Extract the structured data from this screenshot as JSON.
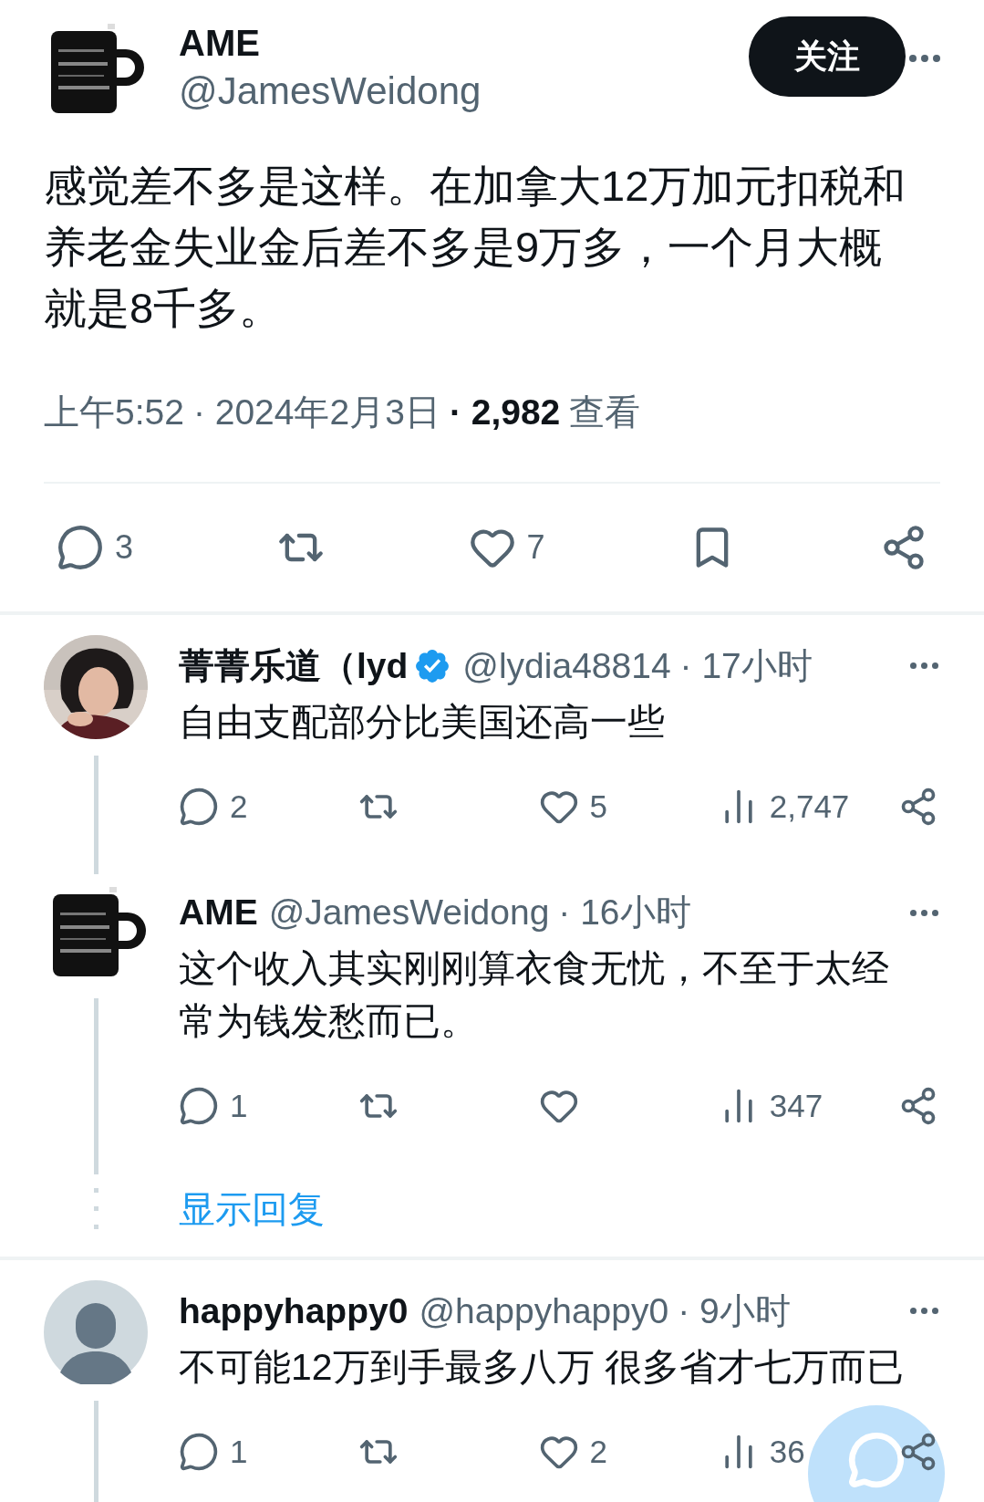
{
  "main_tweet": {
    "avatar": {
      "kind": "mug"
    },
    "author_name": "AME",
    "handle": "@JamesWeidong",
    "follow_button": "关注",
    "body": "感觉差不多是这样。在加拿大12万加元扣税和养老金失业金后差不多是9万多，一个月大概就是8千多。",
    "time": "上午5:52",
    "date": "· 2024年2月3日",
    "views": "· 2,982",
    "views_label": "查看",
    "actions": [
      {
        "kind": "reply",
        "count": "3"
      },
      {
        "kind": "retweet"
      },
      {
        "kind": "like",
        "count": "7"
      },
      {
        "kind": "bookmark"
      },
      {
        "kind": "share"
      }
    ]
  },
  "threads": [
    {
      "replies": [
        {
          "name": "菁菁乐道（lyd",
          "verified": true,
          "handle": "@lydia48814",
          "time": "· 17小时",
          "text": "自由支配部分比美国还高一些",
          "actions": [
            {
              "kind": "reply",
              "count": "2"
            },
            {
              "kind": "retweet"
            },
            {
              "kind": "like",
              "count": "5"
            },
            {
              "kind": "views",
              "count": "2,747"
            },
            {
              "kind": "share"
            }
          ]
        },
        {
          "avatar": {
            "kind": "mug"
          },
          "name": "AME",
          "verified": false,
          "handle": "@JamesWeidong",
          "time": "· 16小时",
          "text": "这个收入其实刚刚算衣食无忧，不至于太经常为钱发愁而已。",
          "actions": [
            {
              "kind": "reply",
              "count": "1"
            },
            {
              "kind": "retweet"
            },
            {
              "kind": "like"
            },
            {
              "kind": "views",
              "count": "347"
            },
            {
              "kind": "share"
            }
          ]
        }
      ],
      "show_replies": "显示回复"
    },
    {
      "replies": [
        {
          "avatar": {
            "kind": "default"
          },
          "name": "happyhappy0",
          "verified": false,
          "handle": "@happyhappy0",
          "time": "· 9小时",
          "text": "不可能12万到手最多八万 很多省才七万而已",
          "actions": [
            {
              "kind": "reply",
              "count": "1"
            },
            {
              "kind": "retweet"
            },
            {
              "kind": "like",
              "count": "2"
            },
            {
              "kind": "views",
              "count": "36"
            },
            {
              "kind": "share"
            }
          ]
        }
      ]
    }
  ]
}
